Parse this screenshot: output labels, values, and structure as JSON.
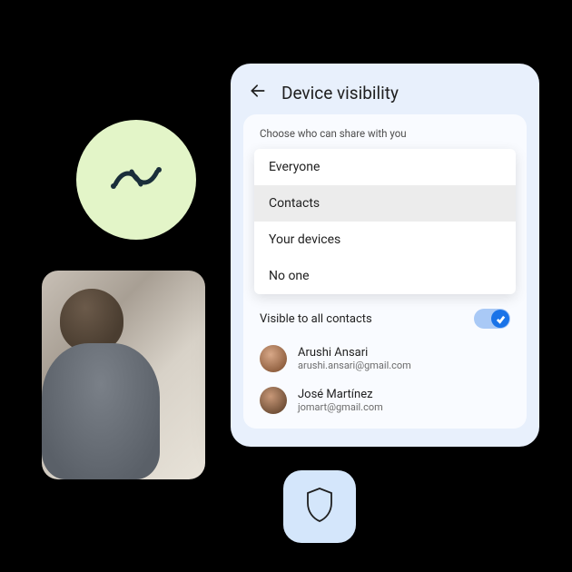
{
  "header": {
    "title": "Device visibility"
  },
  "panel": {
    "choose_label": "Choose who can share with you",
    "options": {
      "everyone": "Everyone",
      "contacts": "Contacts",
      "your_devices": "Your devices",
      "no_one": "No one"
    },
    "selected_option": "Contacts",
    "toggle_label": "Visible to all contacts",
    "toggle_on": true,
    "contacts": [
      {
        "name": "Arushi Ansari",
        "email": "arushi.ansari@gmail.com"
      },
      {
        "name": "José Martínez",
        "email": "jomart@gmail.com"
      }
    ]
  },
  "decorations": {
    "circle_icon": "nearby-share-icon",
    "badge_icon": "shield-icon"
  }
}
